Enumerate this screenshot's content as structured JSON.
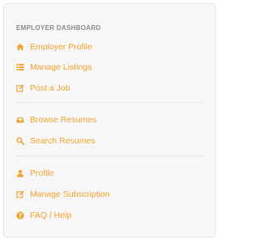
{
  "colors": {
    "accent": "#f2a12e",
    "panel_bg": "#f7f7f7",
    "heading": "#8a8a8a",
    "divider": "#e4e4e4"
  },
  "dashboard": {
    "title": "EMPLOYER DASHBOARD",
    "groups": [
      {
        "items": [
          {
            "label": "Employer Profile",
            "icon": "home-icon"
          },
          {
            "label": "Manage Listings",
            "icon": "list-icon"
          },
          {
            "label": "Post a Job",
            "icon": "edit-icon"
          }
        ]
      },
      {
        "items": [
          {
            "label": "Browse Resumes",
            "icon": "inbox-icon"
          },
          {
            "label": "Search Resumes",
            "icon": "search-icon"
          }
        ]
      },
      {
        "items": [
          {
            "label": "Profile",
            "icon": "user-icon"
          },
          {
            "label": "Manage Subscription",
            "icon": "edit-icon"
          },
          {
            "label": "FAQ / Help",
            "icon": "question-circle-icon"
          }
        ]
      }
    ]
  }
}
